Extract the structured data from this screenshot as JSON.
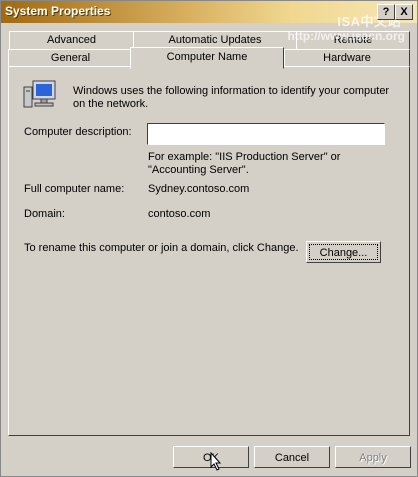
{
  "window": {
    "title": "System Properties",
    "help_label": "?",
    "close_label": "X",
    "watermark": "ISA中文站",
    "watermark_url": "http://www.isacn.org"
  },
  "tabs": [
    {
      "label": "Advanced"
    },
    {
      "label": "Automatic Updates"
    },
    {
      "label": "Remote"
    },
    {
      "label": "General"
    },
    {
      "label": "Computer Name"
    },
    {
      "label": "Hardware"
    }
  ],
  "panel": {
    "intro": "Windows uses the following information to identify your computer on the network.",
    "description_label": "Computer description:",
    "description_value": "",
    "example": "For example: \"IIS Production Server\" or \"Accounting Server\".",
    "full_name_label": "Full computer name:",
    "full_name_value": "Sydney.contoso.com",
    "domain_label": "Domain:",
    "domain_value": "contoso.com",
    "rename_text": "To rename this computer or join a domain, click Change.",
    "change_label": "Change..."
  },
  "buttons": {
    "ok": "OK",
    "cancel": "Cancel",
    "apply": "Apply"
  },
  "icons": {
    "computer": "computer-icon",
    "cursor": "mouse-pointer-icon"
  }
}
